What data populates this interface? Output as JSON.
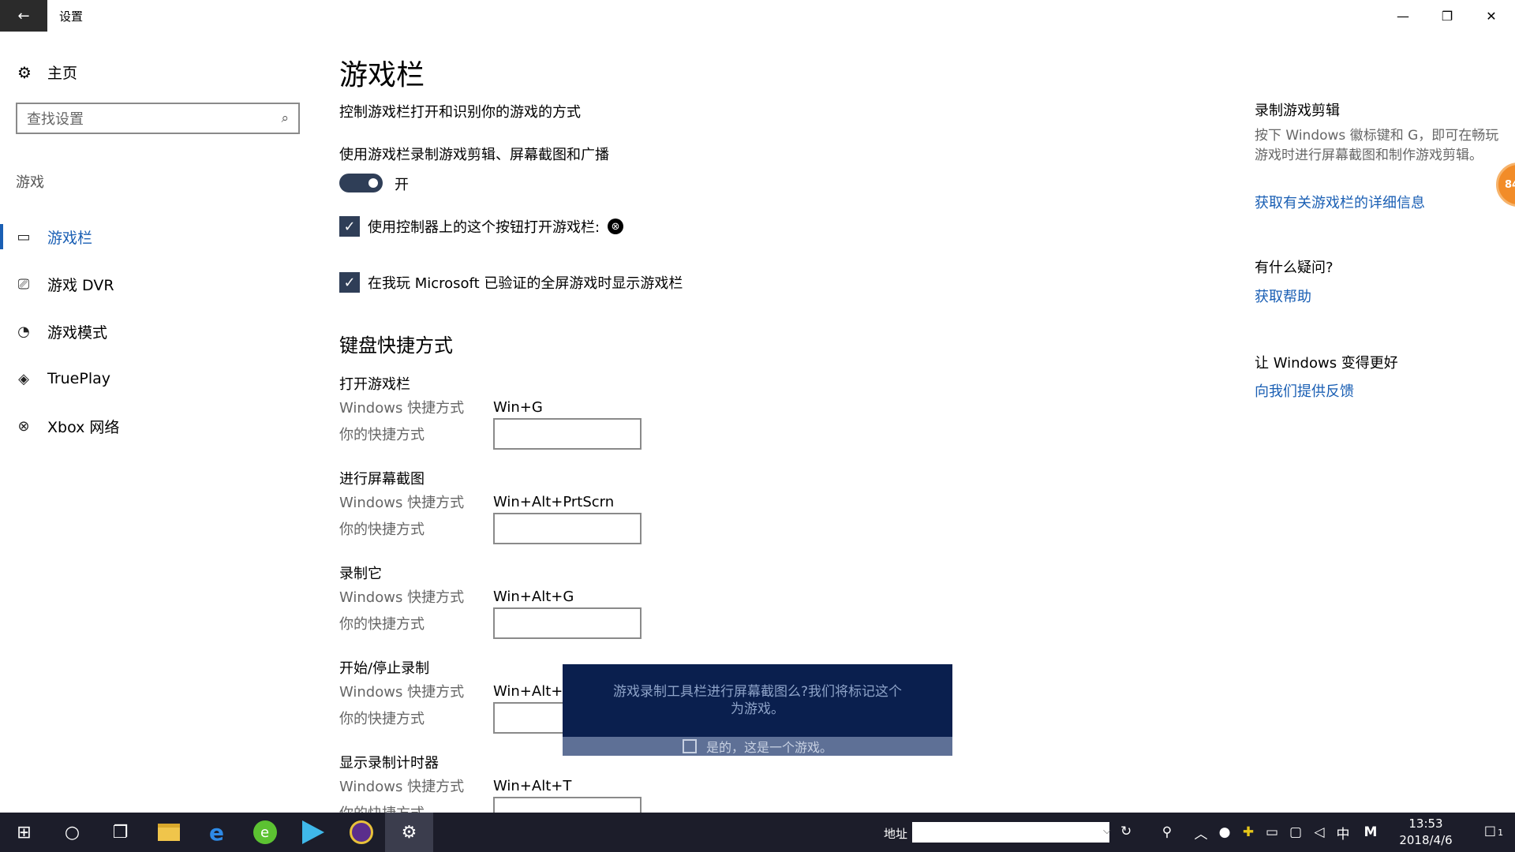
{
  "window": {
    "title": "设置",
    "back_glyph": "←",
    "minimize_glyph": "—",
    "restore_glyph": "❐",
    "close_glyph": "✕"
  },
  "sidebar": {
    "home_label": "主页",
    "search_placeholder": "查找设置",
    "section_label": "游戏",
    "items": [
      {
        "label": "游戏栏",
        "icon": "game-bar-icon",
        "glyph": "▭"
      },
      {
        "label": "游戏 DVR",
        "icon": "game-dvr-icon",
        "glyph": "⎚"
      },
      {
        "label": "游戏模式",
        "icon": "game-mode-icon",
        "glyph": "◔"
      },
      {
        "label": "TruePlay",
        "icon": "trueplay-icon",
        "glyph": "◈"
      },
      {
        "label": "Xbox 网络",
        "icon": "xbox-icon",
        "glyph": "⊗"
      }
    ]
  },
  "main": {
    "title": "游戏栏",
    "description": "控制游戏栏打开和识别你的游戏的方式",
    "toggle_label": "使用游戏栏录制游戏剪辑、屏幕截图和广播",
    "toggle_state": "开",
    "checkbox1_label": "使用控制器上的这个按钮打开游戏栏:",
    "checkbox2_label": "在我玩 Microsoft 已验证的全屏游戏时显示游戏栏",
    "shortcuts_heading": "键盘快捷方式",
    "windows_shortcut_label": "Windows 快捷方式",
    "your_shortcut_label": "你的快捷方式",
    "shortcuts": [
      {
        "title": "打开游戏栏",
        "windows": "Win+G"
      },
      {
        "title": "进行屏幕截图",
        "windows": "Win+Alt+PrtScrn"
      },
      {
        "title": "录制它",
        "windows": "Win+Alt+G"
      },
      {
        "title": "开始/停止录制",
        "windows": "Win+Alt+R"
      },
      {
        "title": "显示录制计时器",
        "windows": "Win+Alt+T"
      }
    ]
  },
  "right": {
    "record_heading": "录制游戏剪辑",
    "record_text": "按下 Windows 徽标键和 G，即可在畅玩游戏时进行屏幕截图和制作游戏剪辑。",
    "record_link": "获取有关游戏栏的详细信息",
    "question_heading": "有什么疑问?",
    "question_link": "获取帮助",
    "better_heading": "让 Windows 变得更好",
    "better_link": "向我们提供反馈",
    "badge_text": "84"
  },
  "popup": {
    "message": "游戏录制工具栏进行屏幕截图么?我们将标记这个为游戏。",
    "checkbox_label": "是的，这是一个游戏。"
  },
  "taskbar": {
    "address_label": "地址",
    "time": "13:53",
    "date": "2018/4/6",
    "ime": "中",
    "ime_mode": "M",
    "notification_count": "1"
  }
}
